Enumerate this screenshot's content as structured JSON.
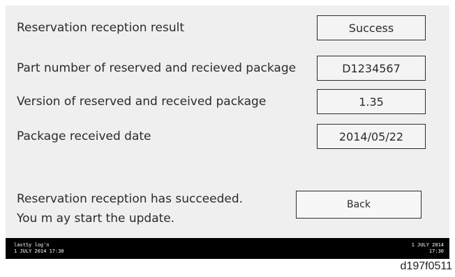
{
  "rows": [
    {
      "label": "Reservation reception result",
      "value": "Success"
    },
    {
      "label": "Part number of reserved and recieved package",
      "value": "D1234567"
    },
    {
      "label": "Version of reserved and received package",
      "value": "1.35"
    },
    {
      "label": "Package received date",
      "value": "2014/05/22"
    }
  ],
  "message": {
    "line1": "Reservation reception has succeeded.",
    "line2": "You m ay start the update."
  },
  "back_button_label": "Back",
  "status_bar": {
    "left_line1": "lastSy log'n",
    "left_line2": "1 JULY 2014 17:30",
    "right_line1": "1 JULY 2014",
    "right_line2": "17:30"
  },
  "figure_id": "d197f0511"
}
